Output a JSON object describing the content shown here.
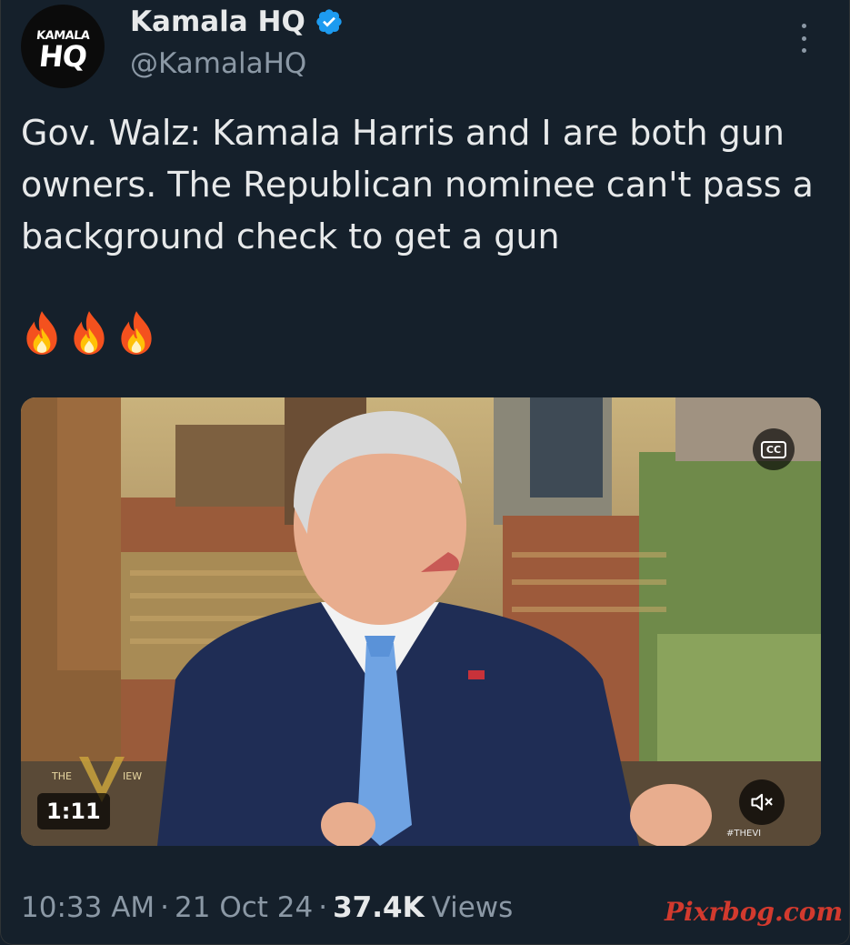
{
  "author": {
    "avatar_top_text": "KAMALA",
    "avatar_bottom_text": "HQ",
    "name": "Kamala HQ",
    "handle": "@KamalaHQ",
    "verified_color": "#1d9bf0"
  },
  "tweet": {
    "text": "Gov. Walz: Kamala Harris and I are both gun owners. The Republican nominee can't pass a background check to get a gun",
    "emojis": [
      "fire-emoji",
      "fire-emoji",
      "fire-emoji"
    ]
  },
  "video": {
    "cc_label": "CC",
    "duration": "1:11",
    "show_logo_left": "THE",
    "show_logo_right": "IEW",
    "network_tag": "#THEVI",
    "mute_icon": "speaker-muted-icon"
  },
  "meta": {
    "time": "10:33 AM",
    "date": "21 Oct 24",
    "views_count": "37.4K",
    "views_label": "Views",
    "separator": "·"
  },
  "watermark": "Pixrbog.com",
  "colors": {
    "background": "#15202b",
    "text_primary": "#e7e9ea",
    "text_secondary": "#8b98a5",
    "verified": "#1d9bf0",
    "watermark": "#d23a2e"
  }
}
